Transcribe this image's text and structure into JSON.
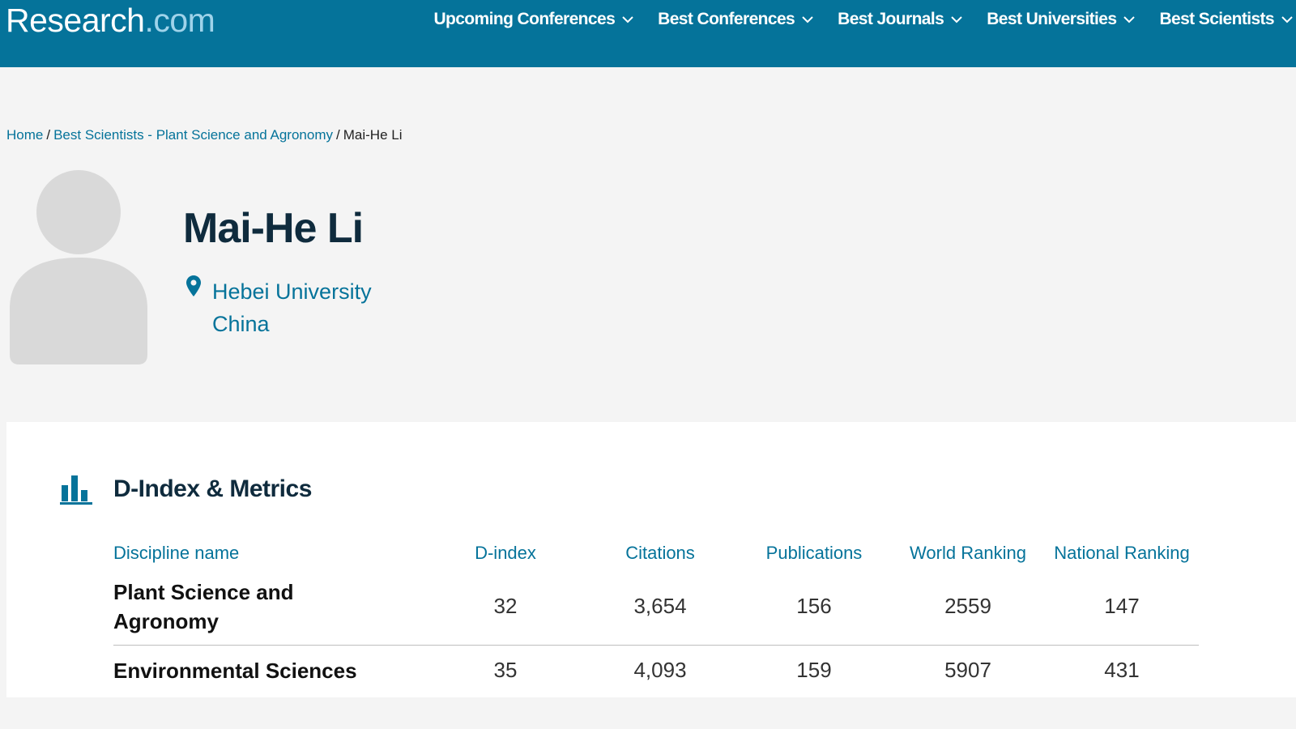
{
  "header": {
    "logo_main": "Research",
    "logo_tld": ".com",
    "nav": [
      {
        "label": "Upcoming Conferences",
        "icon": "chevron-down-icon"
      },
      {
        "label": "Best Conferences",
        "icon": "chevron-down-icon"
      },
      {
        "label": "Best Journals",
        "icon": "chevron-down-icon"
      },
      {
        "label": "Best Universities",
        "icon": "chevron-down-icon"
      },
      {
        "label": "Best Scientists",
        "icon": "chevron-down-icon"
      }
    ]
  },
  "breadcrumb": {
    "home": "Home",
    "separator": "/",
    "category": "Best Scientists - Plant Science and Agronomy",
    "current": "Mai-He Li"
  },
  "profile": {
    "name": "Mai-He Li",
    "institution": "Hebei University",
    "country": "China",
    "avatar_icon": "user-placeholder-icon",
    "location_icon": "map-pin-icon"
  },
  "metrics": {
    "title": "D-Index & Metrics",
    "icon": "bar-chart-icon",
    "columns": [
      "Discipline name",
      "D-index",
      "Citations",
      "Publications",
      "World Ranking",
      "National Ranking"
    ],
    "rows": [
      {
        "discipline": "Plant Science and Agronomy",
        "d_index": "32",
        "citations": "3,654",
        "publications": "156",
        "world_ranking": "2559",
        "national_ranking": "147"
      },
      {
        "discipline": "Environmental Sciences",
        "d_index": "35",
        "citations": "4,093",
        "publications": "159",
        "world_ranking": "5907",
        "national_ranking": "431"
      }
    ]
  },
  "colors": {
    "brand": "#05739a",
    "logo_tld": "#9fd3ea",
    "heading": "#0f2b3d",
    "page_bg": "#f4f4f4",
    "avatar": "#d9d9d9"
  }
}
